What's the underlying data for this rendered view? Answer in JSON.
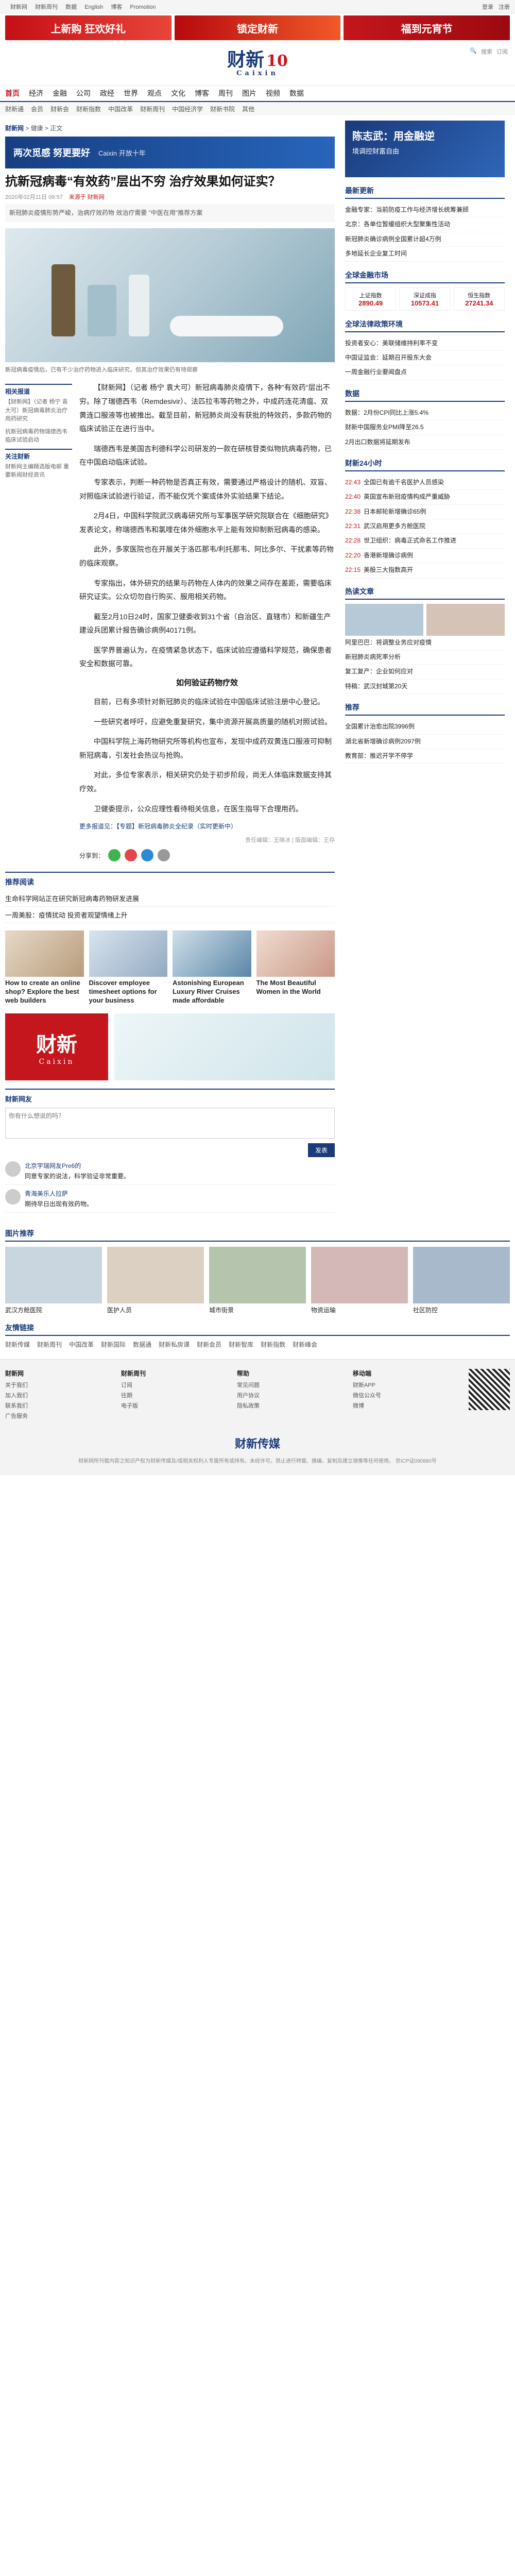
{
  "topbar": {
    "links": [
      "财新网",
      "财新周刊",
      "数据",
      "English",
      "博客",
      "Promotion"
    ],
    "right": [
      "登录",
      "注册"
    ]
  },
  "banners": [
    "上新购 狂欢好礼",
    "锁定财新",
    "福到元宵节"
  ],
  "brand": {
    "logo": "财新",
    "sub": "Caixin",
    "ten": "10"
  },
  "header_tools": [
    "搜索",
    "订阅"
  ],
  "nav_primary": [
    "首页",
    "经济",
    "金融",
    "公司",
    "政经",
    "世界",
    "观点",
    "文化",
    "博客",
    "周刊",
    "图片",
    "视频",
    "数据"
  ],
  "nav_secondary": [
    "财新通",
    "会员",
    "财新会",
    "财新指数",
    "中国改革",
    "财新周刊",
    "中国经济学",
    "财新书院",
    "其他"
  ],
  "crumb": {
    "site": "财新网",
    "sep": " > ",
    "cat": "健康",
    "current": "正文"
  },
  "top_ad": {
    "t1": "两次觅感 努更要好",
    "t2": "Caixin 开放十年"
  },
  "article": {
    "title": "抗新冠病毒“有效药”层出不穷 治疗效果如何证实？",
    "date": "2020年02月11日 09:57",
    "source": "来源于 财新网",
    "summary": "新冠肺炎疫情形势严峻，治病疗效药物 效治疗需要 \"中医在用\"推荐方案",
    "caption": "新冠病毒疫情后，已有不少治疗药物进入临床研究，但其治疗效果仍有待观察",
    "side_tags": [
      {
        "h": "相关报道",
        "items": [
          "【财新网】（记者 杨宁 袁大可）新冠病毒肺炎治疗用药研究",
          "抗新冠病毒药物瑞德西韦临床试验启动"
        ]
      },
      {
        "h": "关注财新",
        "items": [
          "财新网主编精选版电邮 重要新闻财经资讯"
        ]
      }
    ],
    "paragraphs": [
      "【财新网】（记者 杨宁 袁大可）新冠病毒肺炎疫情下，各种\"有效药\"层出不穷。除了瑞德西韦（Remdesivir）、法匹拉韦等药物之外，中成药连花清瘟、双黄连口服液等也被推出。截至目前，新冠肺炎尚没有获批的特效药，多款药物的临床试验正在进行当中。",
      "瑞德西韦是美国吉利德科学公司研发的一款在研核苷类似物抗病毒药物，已在中国启动临床试验。",
      "专家表示，判断一种药物是否真正有效，需要通过严格设计的随机、双盲、对照临床试验进行验证，而不能仅凭个案或体外实验结果下结论。",
      "2月4日，中国科学院武汉病毒研究所与军事医学研究院联合在《细胞研究》发表论文，称瑞德西韦和氯喹在体外细胞水平上能有效抑制新冠病毒的感染。",
      "此外，多家医院也在开展关于洛匹那韦/利托那韦、阿比多尔、干扰素等药物的临床观察。",
      "专家指出，体外研究的结果与药物在人体内的效果之间存在差距，需要临床研究证实。公众切勿自行购买、服用相关药物。",
      "截至2月10日24时，国家卫健委收到31个省（自治区、直辖市）和新疆生产建设兵团累计报告确诊病例40171例。",
      "医学界普遍认为，在疫情紧急状态下，临床试验应遵循科学规范，确保患者安全和数据可靠。"
    ],
    "subhead": "如何验证药物疗效",
    "paragraphs2": [
      "目前，已有多项针对新冠肺炎的临床试验在中国临床试验注册中心登记。",
      "一些研究者呼吁，应避免重复研究，集中资源开展高质量的随机对照试验。",
      "中国科学院上海药物研究所等机构也宣布，发现中成药双黄连口服液可抑制新冠病毒，引发社会热议与抢购。",
      "对此，多位专家表示，相关研究仍处于初步阶段，尚无人体临床数据支持其疗效。",
      "卫健委提示，公众应理性看待相关信息，在医生指导下合理用药。"
    ],
    "note": "更多报道见：【专题】新冠病毒肺炎全纪录（实时更新中）",
    "editor": "责任编辑：王晓冰 | 版面编辑：王存",
    "share_label": "分享到："
  },
  "related": {
    "hd": "推荐阅读",
    "items": [
      "生命科学网站正在研究新冠病毒药物研发进展",
      "一周美股：疫情扰动 投资者观望情绪上升"
    ]
  },
  "ads4": [
    {
      "t": "How to create an online shop? Explore the best web builders"
    },
    {
      "t": "Discover employee timesheet options for your business"
    },
    {
      "t": "Astonishing European Luxury River Cruises made affordable"
    },
    {
      "t": "The Most Beautiful Women in the World"
    }
  ],
  "caixin_promo": {
    "a": "财新",
    "b": "Caixin"
  },
  "comment": {
    "hd": "财新网友",
    "placeholder": "你有什么想说的吗？",
    "submit": "发表",
    "items": [
      {
        "n": "北京宇瑞网友Pre6的",
        "t": "同意专家的说法，科学验证非常重要。"
      },
      {
        "n": "青海美乐人拉萨",
        "t": "期待早日出现有效药物。"
      }
    ]
  },
  "sidebar": {
    "ad": {
      "t1": "陈志武：用金融逆",
      "t2": "境调控财富自由"
    },
    "hot": {
      "hd": "最新更新",
      "items": [
        "金融专家：当前防疫工作与经济增长统筹兼顾",
        "北京：各单位暂缓组织大型聚集性活动",
        "新冠肺炎确诊病例全国累计超4万例",
        "多地延长企业复工时间"
      ]
    },
    "market": {
      "hd": "全球金融市场",
      "items": [
        {
          "n": "上证指数",
          "v": "2890.49"
        },
        {
          "n": "深证成指",
          "v": "10573.41"
        },
        {
          "n": "恒生指数",
          "v": "27241.34"
        }
      ]
    },
    "policy": {
      "hd": "全球法律政策环境",
      "items": [
        "投资者安心：美联储维持利率不变",
        "中国证监会：延期召开股东大会",
        "一周金融行业要闻盘点"
      ]
    },
    "data": {
      "hd": "数据",
      "items": [
        "数据：2月份CPI同比上涨5.4%",
        "财新中国服务业PMI降至26.5",
        "2月出口数据将延期发布"
      ]
    },
    "latest": {
      "hd": "财新24小时",
      "items": [
        {
          "tm": "22:43",
          "t": "全国已有逾千名医护人员感染"
        },
        {
          "tm": "22:40",
          "t": "英国宣布新冠疫情构成严重威胁"
        },
        {
          "tm": "22:38",
          "t": "日本邮轮新增确诊65例"
        },
        {
          "tm": "22:31",
          "t": "武汉启用更多方舱医院"
        },
        {
          "tm": "22:28",
          "t": "世卫组织：病毒正式命名工作推进"
        },
        {
          "tm": "22:20",
          "t": "香港新增确诊病例"
        },
        {
          "tm": "22:15",
          "t": "美股三大指数高开"
        }
      ]
    },
    "hot2": {
      "hd": "热读文章",
      "items": [
        "阿里巴巴：将调整业务应对疫情",
        "新冠肺炎病死率分析",
        "复工复产：企业如何应对",
        "特稿：武汉封城第20天"
      ]
    },
    "recommend": {
      "hd": "推荐",
      "items": [
        "全国累计治愈出院3996例",
        "湖北省新增确诊病例2097例",
        "教育部：推迟开学不停学"
      ]
    }
  },
  "pictures": {
    "hd": "图片推荐",
    "items": [
      "武汉方舱医院",
      "医护人员",
      "城市街景",
      "物资运输",
      "社区防控"
    ]
  },
  "friend_links": {
    "hd": "友情链接",
    "items": [
      "财新传媒",
      "财新周刊",
      "中国改革",
      "财新国际",
      "数据通",
      "财新私房课",
      "财新会员",
      "财新智库",
      "财新指数",
      "财新峰会"
    ]
  },
  "footer": {
    "cols": [
      {
        "ch": "财新网",
        "items": [
          "关于我们",
          "加入我们",
          "联系我们",
          "广告服务"
        ]
      },
      {
        "ch": "财新周刊",
        "items": [
          "订阅",
          "往期",
          "电子版"
        ]
      },
      {
        "ch": "帮助",
        "items": [
          "常见问题",
          "用户协议",
          "隐私政策"
        ]
      },
      {
        "ch": "移动端",
        "items": [
          "财新APP",
          "微信公众号",
          "微博"
        ]
      }
    ],
    "logo": "财新传媒",
    "copy": "财新网所刊载内容之知识产权为财新传媒及/或相关权利人专属所有或持有。未经许可，禁止进行转载、摘编、复制及建立镜像等任何使用。 京ICP证090880号"
  },
  "colors": {
    "accent": "#1a3a7a",
    "brand_red": "#c4161c"
  }
}
